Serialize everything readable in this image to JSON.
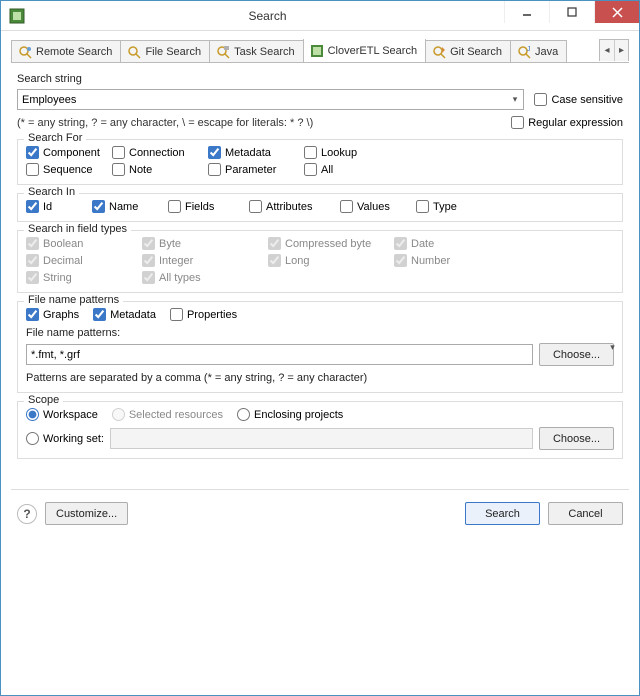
{
  "window": {
    "title": "Search"
  },
  "tabs": [
    {
      "label": "Remote Search"
    },
    {
      "label": "File Search"
    },
    {
      "label": "Task Search"
    },
    {
      "label": "CloverETL Search"
    },
    {
      "label": "Git Search"
    },
    {
      "label": "Java"
    }
  ],
  "search_string": {
    "label": "Search string",
    "value": "Employees",
    "case_sensitive_label": "Case sensitive",
    "hint": "(* = any string, ? = any character, \\ = escape for literals: * ? \\)",
    "regex_label": "Regular expression"
  },
  "search_for": {
    "title": "Search For",
    "items": [
      {
        "label": "Component",
        "checked": true
      },
      {
        "label": "Connection",
        "checked": false
      },
      {
        "label": "Metadata",
        "checked": true
      },
      {
        "label": "Lookup",
        "checked": false
      },
      {
        "label": "Sequence",
        "checked": false
      },
      {
        "label": "Note",
        "checked": false
      },
      {
        "label": "Parameter",
        "checked": false
      },
      {
        "label": "All",
        "checked": false
      }
    ]
  },
  "search_in": {
    "title": "Search In",
    "items": [
      {
        "label": "Id",
        "checked": true
      },
      {
        "label": "Name",
        "checked": true
      },
      {
        "label": "Fields",
        "checked": false
      },
      {
        "label": "Attributes",
        "checked": false
      },
      {
        "label": "Values",
        "checked": false
      },
      {
        "label": "Type",
        "checked": false
      }
    ]
  },
  "field_types": {
    "title": "Search in field types",
    "items": [
      {
        "label": "Boolean"
      },
      {
        "label": "Byte"
      },
      {
        "label": "Compressed byte"
      },
      {
        "label": "Date"
      },
      {
        "label": "Decimal"
      },
      {
        "label": "Integer"
      },
      {
        "label": "Long"
      },
      {
        "label": "Number"
      },
      {
        "label": "String"
      },
      {
        "label": "All types"
      }
    ]
  },
  "patterns": {
    "title": "File name patterns",
    "graphs_label": "Graphs",
    "metadata_label": "Metadata",
    "properties_label": "Properties",
    "label": "File name patterns:",
    "value": "*.fmt, *.grf",
    "choose_label": "Choose...",
    "hint": "Patterns are separated by a comma (* = any string, ? = any character)"
  },
  "scope": {
    "title": "Scope",
    "workspace_label": "Workspace",
    "selected_resources_label": "Selected resources",
    "enclosing_projects_label": "Enclosing projects",
    "working_set_label": "Working set:",
    "choose_label": "Choose..."
  },
  "footer": {
    "customize_label": "Customize...",
    "search_label": "Search",
    "cancel_label": "Cancel"
  }
}
